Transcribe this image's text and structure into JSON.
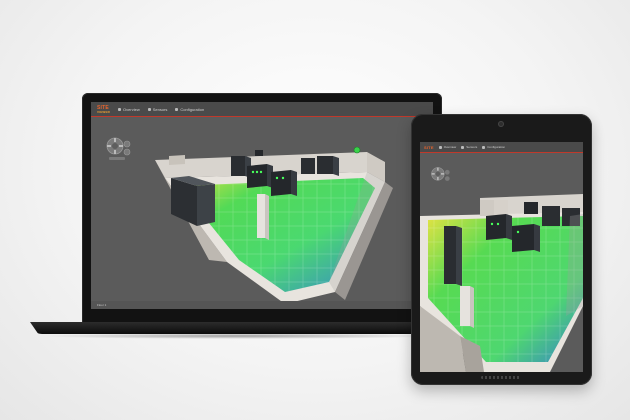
{
  "app": {
    "logo": "SITE",
    "logo_sub": "VIEWER",
    "tabs": [
      "Overview",
      "Sensors",
      "Configuration"
    ]
  },
  "status": {
    "left_label": "Floor 1"
  },
  "colors": {
    "accent": "#e8632c",
    "heat_green": "#3fd95a",
    "heat_blue": "#2f7fc8",
    "heat_yellow": "#e4e23a",
    "background": "#5b5b5b"
  },
  "icons": [
    "navigation-pad-icon",
    "zoom-icon",
    "camera-icon"
  ]
}
